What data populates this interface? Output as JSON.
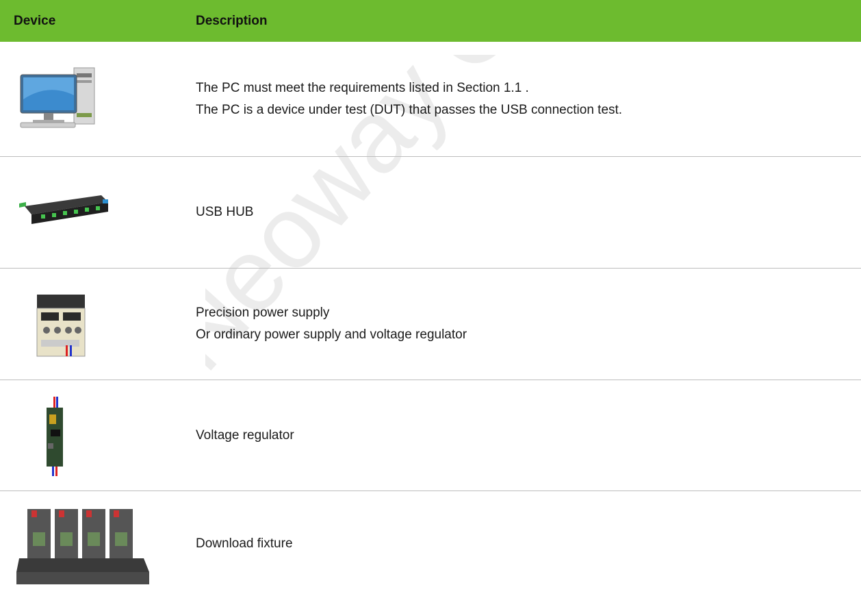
{
  "table": {
    "headers": {
      "device": "Device",
      "description": "Description"
    },
    "rows": [
      {
        "icon": "desktop-pc-icon",
        "lines": [
          "The PC must meet the requirements listed in Section 1.1 .",
          "The PC is a device under test (DUT) that passes the USB connection test."
        ]
      },
      {
        "icon": "usb-hub-icon",
        "lines": [
          "USB HUB"
        ]
      },
      {
        "icon": "power-supply-icon",
        "lines": [
          "Precision power supply",
          "Or ordinary power supply and voltage regulator"
        ]
      },
      {
        "icon": "voltage-regulator-icon",
        "lines": [
          "Voltage regulator"
        ]
      },
      {
        "icon": "download-fixture-icon",
        "lines": [
          "Download fixture"
        ]
      }
    ]
  },
  "watermark": {
    "text": "Neoway Confidential"
  }
}
